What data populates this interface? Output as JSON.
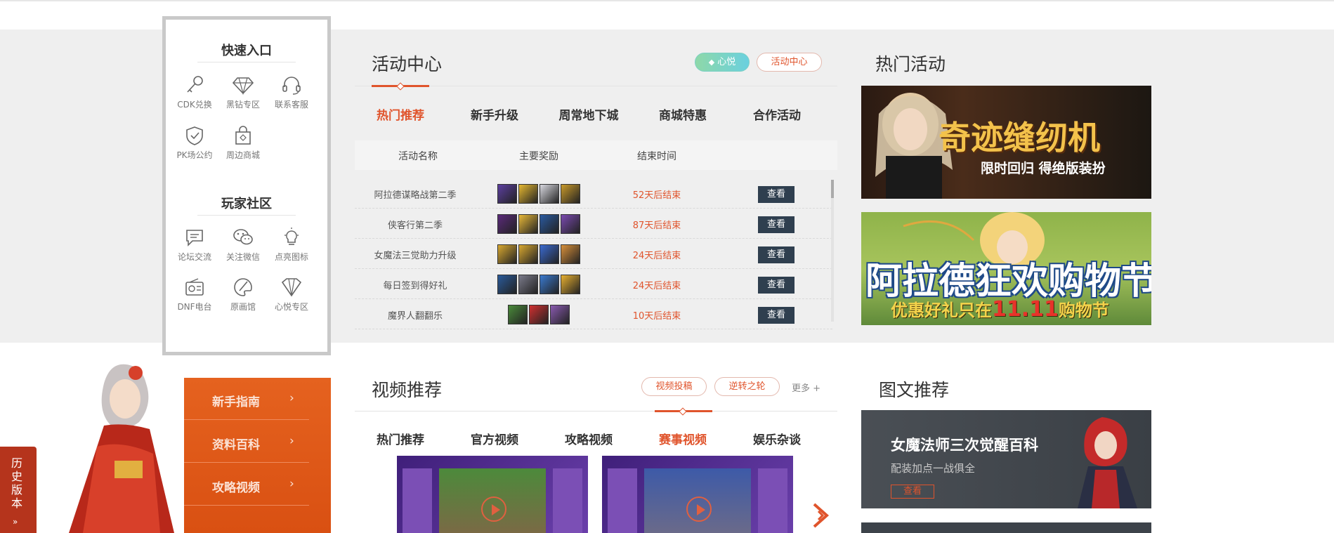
{
  "quick_entry": {
    "title": "快速入口",
    "items": [
      {
        "label": "CDK兑换",
        "icon": "key-icon"
      },
      {
        "label": "黑钻专区",
        "icon": "diamond-icon"
      },
      {
        "label": "联系客服",
        "icon": "headset-icon"
      },
      {
        "label": "PK场公约",
        "icon": "shield-check-icon"
      },
      {
        "label": "周边商城",
        "icon": "shopping-bag-icon"
      }
    ]
  },
  "community": {
    "title": "玩家社区",
    "items": [
      {
        "label": "论坛交流",
        "icon": "forum-icon"
      },
      {
        "label": "关注微信",
        "icon": "wechat-icon"
      },
      {
        "label": "点亮图标",
        "icon": "lightbulb-icon"
      },
      {
        "label": "DNF电台",
        "icon": "radio-icon"
      },
      {
        "label": "原画馆",
        "icon": "palette-icon"
      },
      {
        "label": "心悦专区",
        "icon": "gem-icon"
      }
    ]
  },
  "activity": {
    "title": "活动中心",
    "pill_green": "心悦",
    "pill_red": "活动中心",
    "tabs": [
      "热门推荐",
      "新手升级",
      "周常地下城",
      "商城特惠",
      "合作活动"
    ],
    "active_tab": 0,
    "columns": [
      "活动名称",
      "主要奖励",
      "结束时间"
    ],
    "rows": [
      {
        "name": "阿拉德谋略战第二季",
        "time": "52天后结束",
        "action": "查看",
        "rewards": 4
      },
      {
        "name": "侠客行第二季",
        "time": "87天后结束",
        "action": "查看",
        "rewards": 4
      },
      {
        "name": "女魔法三觉助力升级",
        "time": "24天后结束",
        "action": "查看",
        "rewards": 4
      },
      {
        "name": "每日签到得好礼",
        "time": "24天后结束",
        "action": "查看",
        "rewards": 4
      },
      {
        "name": "魔界人翻翻乐",
        "time": "10天后结束",
        "action": "查看",
        "rewards": 3
      }
    ]
  },
  "hot": {
    "title": "热门活动",
    "banners": [
      {
        "title": "奇迹缝纫机",
        "subtitle": "限时回归 得绝版装扮"
      },
      {
        "title": "阿拉德狂欢购物节",
        "subtitle_pre": "优惠好礼只在",
        "subtitle_num": "11.11",
        "subtitle_post": "购物节"
      }
    ]
  },
  "guide": {
    "items": [
      "新手指南",
      "资料百科",
      "攻略视频"
    ],
    "arrow": "›"
  },
  "history": {
    "label": "历史版本",
    "arrow": "»"
  },
  "video": {
    "title": "视频推荐",
    "pills": [
      "视频投稿",
      "逆转之轮"
    ],
    "more": "更多 +",
    "tabs": [
      "热门推荐",
      "官方视频",
      "攻略视频",
      "赛事视频",
      "娱乐杂谈"
    ],
    "active_tab": 3
  },
  "image_text": {
    "title": "图文推荐",
    "card_title": "女魔法师三次觉醒百科",
    "card_subtitle": "配装加点一战俱全",
    "card_button": "查看"
  },
  "colors": {
    "accent": "#e0542c",
    "button_dark": "#2f3f4f",
    "guide_orange": "#e0581a"
  }
}
